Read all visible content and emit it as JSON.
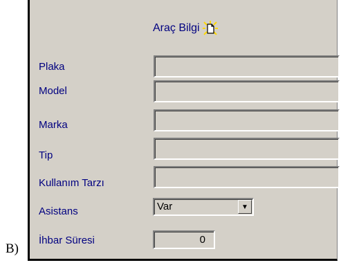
{
  "outer_label": "B)",
  "form": {
    "title": "Araç Bilgi",
    "fields": [
      {
        "label": "Plaka",
        "value": ""
      },
      {
        "label": "Model",
        "value": ""
      },
      {
        "label": "Marka",
        "value": ""
      },
      {
        "label": "Tip",
        "value": ""
      },
      {
        "label": "Kullanım Tarzı",
        "value": ""
      }
    ],
    "asistans": {
      "label": "Asistans",
      "value": "Var"
    },
    "ihbar": {
      "label": "İhbar Süresi",
      "value": "0"
    }
  },
  "colors": {
    "label": "#000080",
    "panel": "#d4d0c8"
  }
}
